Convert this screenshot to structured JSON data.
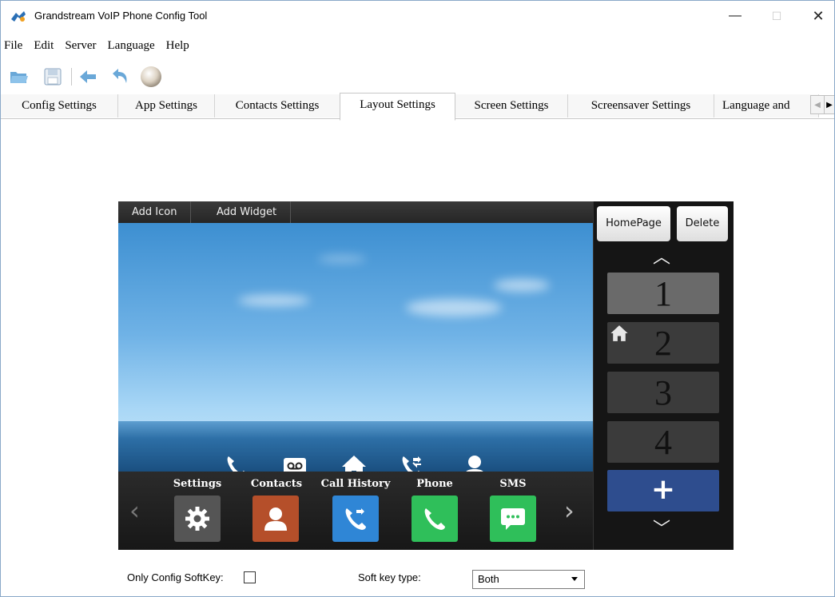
{
  "window": {
    "title": "Grandstream VoIP Phone Config Tool",
    "controls": {
      "minimize": "—",
      "maximize": "☐",
      "close": "✕"
    }
  },
  "menu": [
    "File",
    "Edit",
    "Server",
    "Language",
    "Help"
  ],
  "toolbar": [
    "open-folder-icon",
    "save-icon",
    "back-arrow-icon",
    "undo-icon",
    "sphere-icon"
  ],
  "tabs": [
    {
      "label": "Config Settings",
      "active": false
    },
    {
      "label": "App Settings",
      "active": false
    },
    {
      "label": "Contacts Settings",
      "active": false
    },
    {
      "label": "Layout Settings",
      "active": true
    },
    {
      "label": "Screen Settings",
      "active": false
    },
    {
      "label": "Screensaver Settings",
      "active": false
    },
    {
      "label": "Language and",
      "active": false
    }
  ],
  "phone": {
    "top_buttons": [
      "Add Icon",
      "Add Widget"
    ],
    "dock_icons": [
      "phone-icon",
      "voicemail-icon",
      "home-icon",
      "call-history-icon",
      "contact-icon"
    ],
    "apps": [
      {
        "label": "Settings",
        "icon": "gear-icon",
        "color": "#5a5a5a"
      },
      {
        "label": "Contacts",
        "icon": "person-icon",
        "color": "#b54f2a"
      },
      {
        "label": "Call History",
        "icon": "call-history-icon",
        "color": "#2f86d6"
      },
      {
        "label": "Phone",
        "icon": "phone-icon",
        "color": "#2fbf5a"
      },
      {
        "label": "SMS",
        "icon": "sms-icon",
        "color": "#2fbf5a"
      }
    ],
    "panel": {
      "homepage": "HomePage",
      "delete": "Delete",
      "pages": [
        "1",
        "2",
        "3",
        "4"
      ],
      "selected_page": "1",
      "home_page": "2",
      "add": "+"
    }
  },
  "options": {
    "only_config_softkey_label": "Only Config SoftKey:",
    "only_config_softkey_checked": false,
    "softkey_type_label": "Soft key type:",
    "softkey_type_value": "Both"
  }
}
